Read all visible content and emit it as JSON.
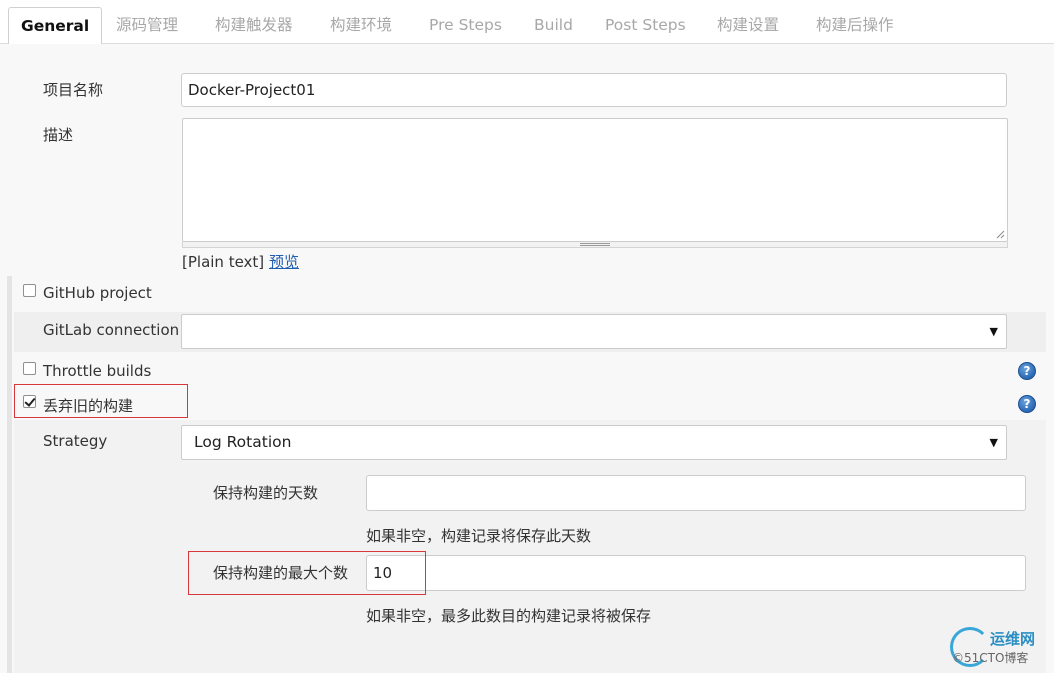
{
  "tabs": [
    {
      "label": "General",
      "active": true
    },
    {
      "label": "源码管理"
    },
    {
      "label": "构建触发器"
    },
    {
      "label": "构建环境"
    },
    {
      "label": "Pre Steps"
    },
    {
      "label": "Build"
    },
    {
      "label": "Post Steps"
    },
    {
      "label": "构建设置"
    },
    {
      "label": "构建后操作"
    }
  ],
  "project_name": {
    "label": "项目名称",
    "value": "Docker-Project01"
  },
  "description": {
    "label": "描述",
    "value": "",
    "format_text": "[Plain text]",
    "preview_link": "预览"
  },
  "github_project": {
    "label": "GitHub project",
    "checked": false
  },
  "gitlab_connection": {
    "label": "GitLab connection",
    "value": ""
  },
  "throttle_builds": {
    "label": "Throttle builds",
    "checked": false
  },
  "discard_old_builds": {
    "label": "丢弃旧的构建",
    "checked": true
  },
  "strategy": {
    "label": "Strategy",
    "value": "Log Rotation"
  },
  "days_to_keep": {
    "label": "保持构建的天数",
    "value": "",
    "hint": "如果非空，构建记录将保存此天数"
  },
  "max_builds": {
    "label": "保持构建的最大个数",
    "value": "10",
    "hint": "如果非空，最多此数目的构建记录将被保存"
  },
  "icons": {
    "help": "help-icon",
    "caret": "▼"
  },
  "colors": {
    "accent": "#1f5eb0",
    "highlight": "#d9383a"
  },
  "watermark": {
    "line1": "运维网",
    "line2": "©51CTO博客"
  }
}
